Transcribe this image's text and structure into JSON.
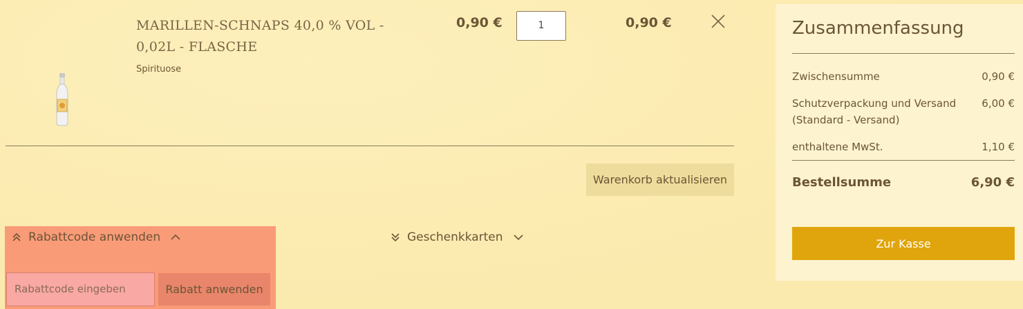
{
  "cart_item": {
    "name": "MARILLEN-SCHNAPS 40,0 % VOL - 0,02L - FLASCHE",
    "category": "Spirituose",
    "unit_price": "0,90 €",
    "quantity": "1",
    "row_total": "0,90 €",
    "image_icon": "bottle-icon",
    "remove_icon": "close-icon"
  },
  "cart_actions": {
    "update_label": "Warenkorb aktualisieren"
  },
  "discount": {
    "toggle_label": "Rabattcode anwenden",
    "input_placeholder": "Rabattcode eingeben",
    "apply_label": "Rabatt anwenden",
    "expand_icon": "double-chevron-up-icon",
    "chevron_icon": "chevron-up-icon"
  },
  "giftcards": {
    "toggle_label": "Geschenkkarten",
    "expand_icon": "double-chevron-down-icon",
    "chevron_icon": "chevron-down-icon"
  },
  "summary": {
    "title": "Zusammenfassung",
    "subtotal_label": "Zwischensumme",
    "subtotal_value": "0,90 €",
    "shipping_label": "Schutzverpackung und Versand (Standard - Versand)",
    "shipping_value": "6,00 €",
    "tax_label": "enthaltene MwSt.",
    "tax_value": "1,10 €",
    "total_label": "Bestellsumme",
    "total_value": "6,90 €",
    "checkout_label": "Zur Kasse"
  },
  "colors": {
    "background": "#fbeaae",
    "text": "#6b5536",
    "checkout_button": "#e0a50c",
    "discount_highlight": "#fa9b78"
  }
}
